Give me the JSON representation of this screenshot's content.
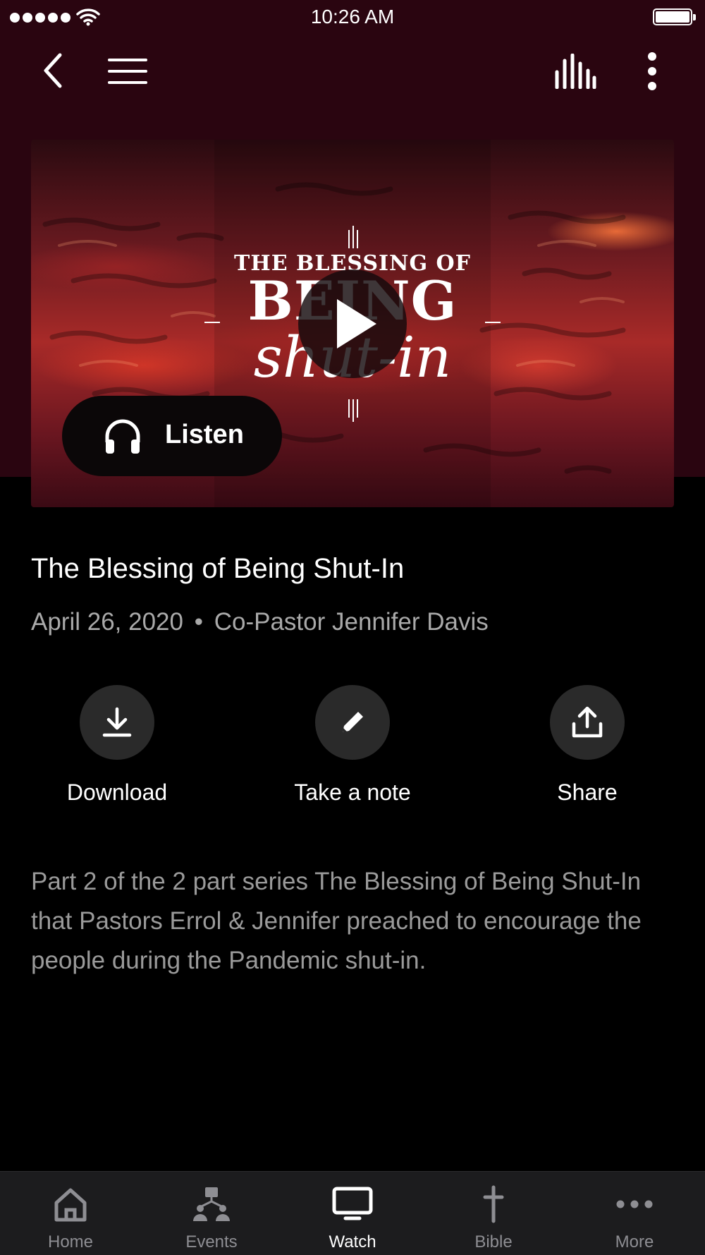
{
  "status_bar": {
    "time": "10:26 AM"
  },
  "nav": {
    "back_icon": "chevron-left-icon",
    "menu_icon": "hamburger-menu-icon",
    "audio_icon": "audio-bars-icon",
    "more_icon": "vertical-dots-icon"
  },
  "hero": {
    "art_line1": "THE BLESSING OF",
    "art_line2": "BEING",
    "art_line3": "shut-in",
    "listen_label": "Listen"
  },
  "sermon": {
    "title": "The Blessing of Being Shut-In",
    "date": "April 26, 2020",
    "separator": "•",
    "speaker": "Co-Pastor Jennifer Davis"
  },
  "actions": [
    {
      "label": "Download",
      "icon": "download-icon"
    },
    {
      "label": "Take a note",
      "icon": "pencil-icon"
    },
    {
      "label": "Share",
      "icon": "share-icon"
    }
  ],
  "description": "Part 2 of the 2 part series The Blessing of Being Shut-In that Pastors Errol & Jennifer preached to encourage the people during the Pandemic shut-in.",
  "tab_bar": {
    "active": "Watch",
    "items": [
      {
        "label": "Home",
        "icon": "home-icon"
      },
      {
        "label": "Events",
        "icon": "events-icon"
      },
      {
        "label": "Watch",
        "icon": "tv-icon"
      },
      {
        "label": "Bible",
        "icon": "cross-icon"
      },
      {
        "label": "More",
        "icon": "more-dots-icon"
      }
    ]
  },
  "colors": {
    "header_bg": "#2a0510",
    "page_bg": "#000000",
    "tab_bar_bg": "#1c1c1e",
    "muted_text": "#9a9a9a"
  }
}
